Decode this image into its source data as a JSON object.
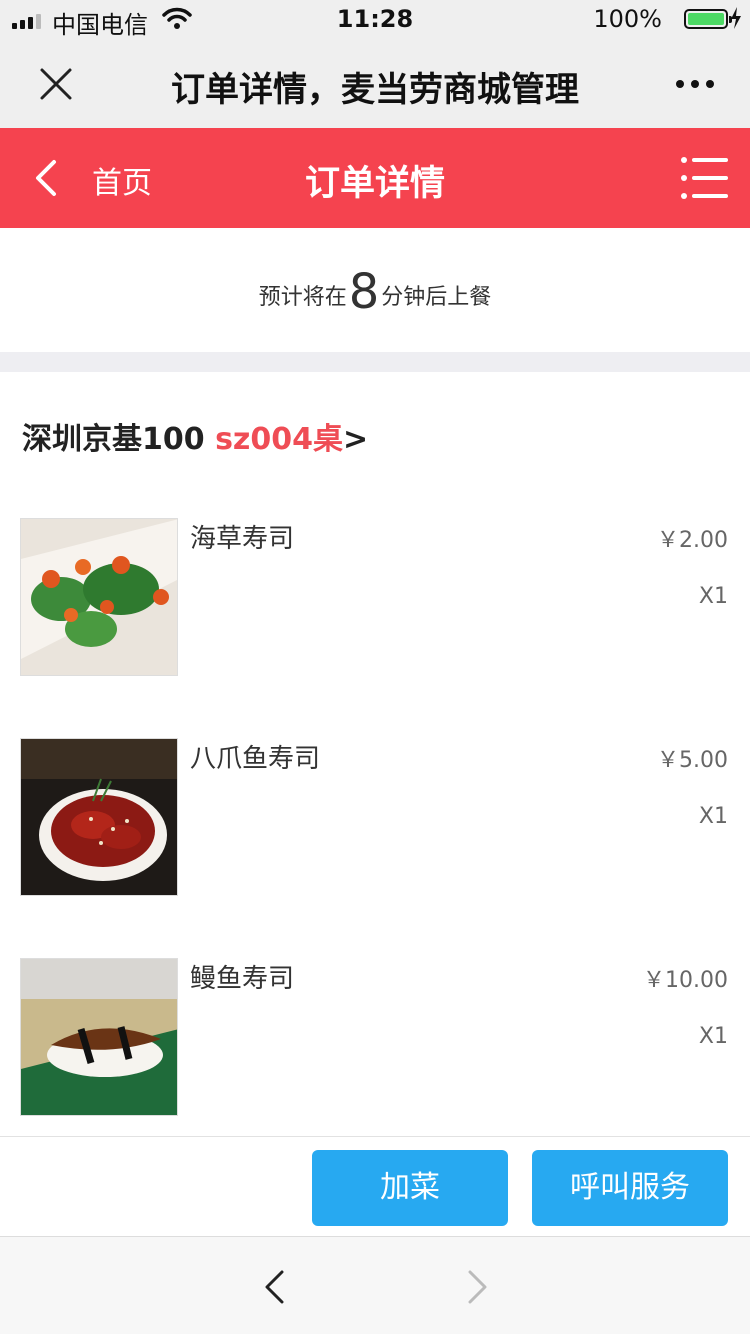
{
  "status_bar": {
    "carrier": "中国电信",
    "time": "11:28",
    "battery": "100%"
  },
  "wechat_header": {
    "title": "订单详情，麦当劳商城管理"
  },
  "app_header": {
    "home_label": "首页",
    "title": "订单详情",
    "accent_color": "#f5434f"
  },
  "estimate": {
    "prefix": "预计将在",
    "minutes": "8",
    "suffix": "分钟后上餐"
  },
  "store": {
    "name": "深圳京基100",
    "table": "sz004桌",
    "arrow": ">"
  },
  "items": [
    {
      "name": "海草寿司",
      "price": "￥2.00",
      "qty": "X1"
    },
    {
      "name": "八爪鱼寿司",
      "price": "￥5.00",
      "qty": "X1"
    },
    {
      "name": "鳗鱼寿司",
      "price": "￥10.00",
      "qty": "X1"
    }
  ],
  "actions": {
    "add_dish": "加菜",
    "call_service": "呼叫服务",
    "button_color": "#27a9f1"
  }
}
